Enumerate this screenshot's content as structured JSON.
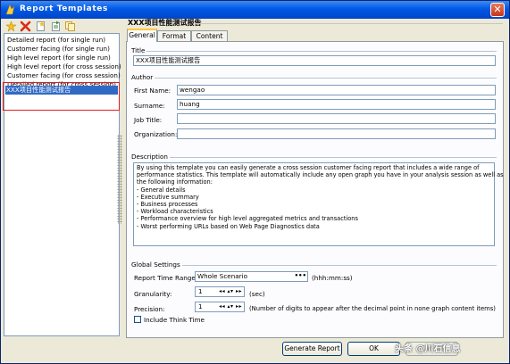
{
  "window": {
    "title": "Report Templates",
    "close_glyph": "✕"
  },
  "toolbar": {
    "icons": [
      "new-star-icon",
      "delete-icon",
      "new-document-icon",
      "import-icon",
      "copy-icon"
    ]
  },
  "templates": [
    "Detailed report (for single run)",
    "Customer facing (for single run)",
    "High level report (for single run)",
    "High level report (for cross session)",
    "Customer facing (for cross session)",
    "Detailed report (for cross session)",
    "XXX项目性能测试报告"
  ],
  "selected_template_index": 6,
  "right_title": "XXX项目性能测试报告",
  "tabs": [
    "General",
    "Format",
    "Content"
  ],
  "active_tab": "General",
  "title_group": {
    "label": "Title",
    "value": "XXX项目性能测试报告"
  },
  "author_group": {
    "label": "Author",
    "first_name_label": "First Name:",
    "first_name": "wengao",
    "surname_label": "Surname:",
    "surname": "huang",
    "job_title_label": "Job Title:",
    "job_title": "",
    "organization_label": "Organization:",
    "organization": ""
  },
  "description_group": {
    "label": "Description",
    "lines": [
      "By using this template you can easily generate a cross session customer facing report that includes a wide range of",
      "performance statistics. This template will automatically include any open graph you have in your analysis session as well as",
      "the following information:",
      "- General details",
      "- Executive summary",
      "- Business processes",
      "- Workload characteristics",
      "- Performance overview for high level aggregated metrics and transactions",
      "- Worst performing URLs based on Web Page Diagnostics data"
    ]
  },
  "global_settings": {
    "label": "Global Settings",
    "report_time_range_label": "Report Time Range:",
    "report_time_range": "Whole Scenario",
    "report_time_range_btn": "•••",
    "time_format": "(hhh:mm:ss)",
    "granularity_label": "Granularity:",
    "granularity": "1",
    "granularity_unit": "(sec)",
    "precision_label": "Precision:",
    "precision": "1",
    "precision_note": "(Number of digits to appear after the decimal point in none graph content items)",
    "spin_controls": "◂◂ ▴▾ ▸▸",
    "include_think_time_label": "Include Think Time",
    "include_think_time": false
  },
  "buttons": {
    "generate_report": "Generate Report",
    "ok": "OK",
    "cancel": "Cancel"
  },
  "watermark": "头条 @川石信息",
  "colors": {
    "titlebar": "#0058e6",
    "selection": "#316ac5",
    "highlight_box": "#e02020",
    "tab_accent": "#ffc83c"
  }
}
